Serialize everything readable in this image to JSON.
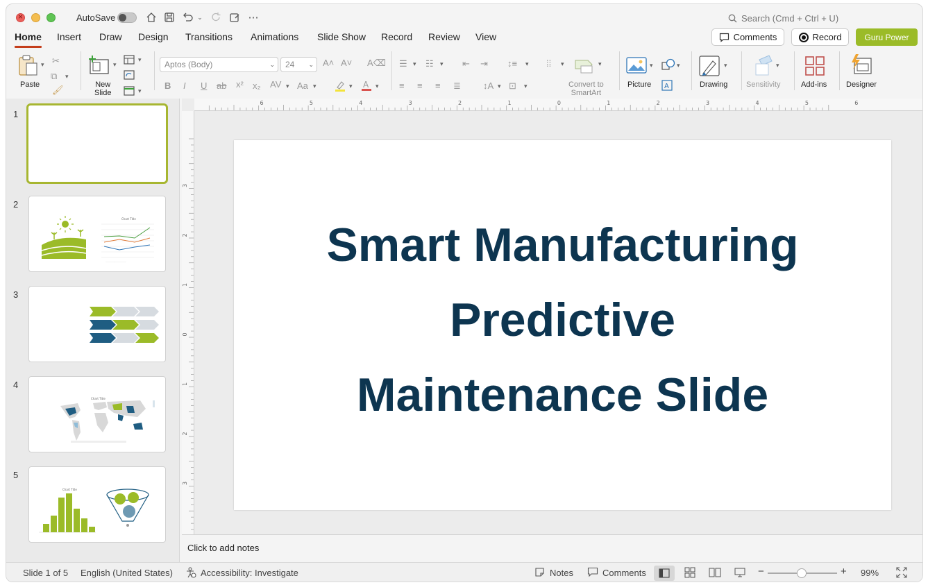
{
  "titlebar": {
    "autosave_label": "AutoSave",
    "search_placeholder": "Search (Cmd + Ctrl + U)"
  },
  "tabs": [
    "Home",
    "Insert",
    "Draw",
    "Design",
    "Transitions",
    "Animations",
    "Slide Show",
    "Record",
    "Review",
    "View"
  ],
  "header_buttons": {
    "comments": "Comments",
    "record": "Record",
    "guru": "Guru Power"
  },
  "ribbon": {
    "paste": "Paste",
    "new_slide_1": "New",
    "new_slide_2": "Slide",
    "font_name": "Aptos (Body)",
    "font_size": "24",
    "convert_1": "Convert to",
    "convert_2": "SmartArt",
    "picture": "Picture",
    "drawing": "Drawing",
    "sensitivity": "Sensitivity",
    "addins": "Add-ins",
    "designer": "Designer"
  },
  "thumbnails": [
    "1",
    "2",
    "3",
    "4",
    "5"
  ],
  "slide": {
    "title_line1": "Smart Manufacturing",
    "title_line2": "Predictive",
    "title_line3": "Maintenance Slide"
  },
  "notes_placeholder": "Click to add notes",
  "status": {
    "slide_count": "Slide 1 of 5",
    "language": "English (United States)",
    "accessibility": "Accessibility: Investigate",
    "notes": "Notes",
    "comments": "Comments",
    "zoom": "99%"
  },
  "ruler": {
    "h_labels": [
      "6",
      "5",
      "4",
      "3",
      "2",
      "1",
      "0",
      "1",
      "2",
      "3",
      "4",
      "5",
      "6"
    ],
    "v_labels": [
      "3",
      "2",
      "1",
      "0",
      "1",
      "2",
      "3"
    ]
  },
  "colors": {
    "accent_green": "#9bbb28",
    "title_navy": "#0d3550",
    "tab_underline": "#c43e1c",
    "selected_thumb": "#a7b631"
  }
}
